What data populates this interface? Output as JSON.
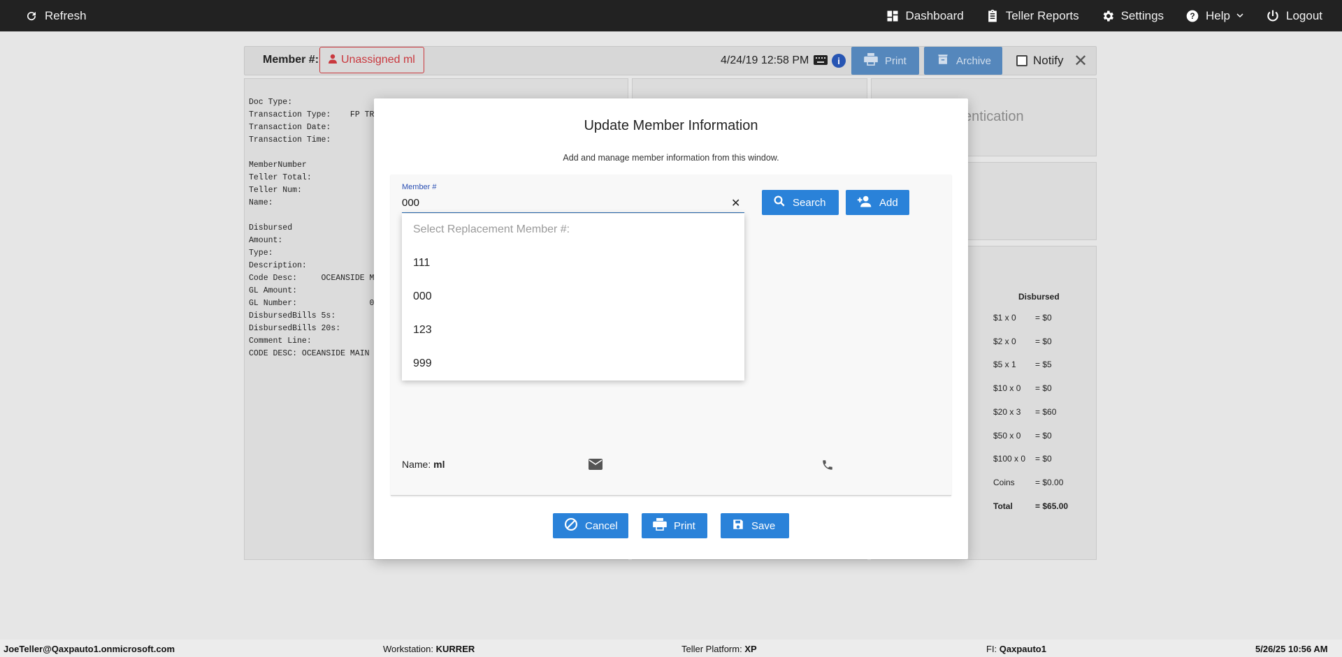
{
  "topnav": {
    "refresh": "Refresh",
    "dashboard": "Dashboard",
    "teller_reports": "Teller Reports",
    "settings": "Settings",
    "help": "Help",
    "logout": "Logout"
  },
  "doc_header": {
    "member_label": "Member #:",
    "unassigned": "Unassigned ml",
    "datetime": "4/24/19 12:58 PM",
    "print": "Print",
    "archive": "Archive",
    "notify": "Notify"
  },
  "doc_text": {
    "lines": [
      "Doc Type:",
      "Transaction Type:    FP TRA",
      "Transaction Date:",
      "Transaction Time:",
      "",
      "MemberNumber",
      "Teller Total:",
      "Teller Num:",
      "Name:",
      "",
      "Disbursed",
      "Amount:",
      "Type:",
      "Description:",
      "Code Desc:     OCEANSIDE MA",
      "GL Amount:",
      "GL Number:               0",
      "DisbursedBills 5s:",
      "DisbursedBills 20s:",
      "Comment Line:",
      "CODE DESC: OCEANSIDE MAIN V"
    ]
  },
  "auth_panel": {
    "partial_title": "entication"
  },
  "disbursed": {
    "title": "Disbursed",
    "rows": [
      {
        "label": "$1 x 0",
        "value": "= $0"
      },
      {
        "label": "$2 x 0",
        "value": "= $0"
      },
      {
        "label": "$5 x 1",
        "value": "= $5"
      },
      {
        "label": "$10 x 0",
        "value": "= $0"
      },
      {
        "label": "$20 x 3",
        "value": "= $60"
      },
      {
        "label": "$50 x 0",
        "value": "= $0"
      },
      {
        "label": "$100 x 0",
        "value": "= $0"
      },
      {
        "label": "Coins",
        "value": "= $0.00"
      },
      {
        "label": "Total",
        "value": "= $65.00"
      }
    ]
  },
  "modal": {
    "title": "Update Member Information",
    "subtitle": "Add and manage member information from this window.",
    "member_field_label": "Member #",
    "member_value": "000",
    "search": "Search",
    "add": "Add",
    "dropdown_placeholder": "Select Replacement Member #:",
    "options": [
      "111",
      "000",
      "123",
      "999"
    ],
    "name_label": "Name:",
    "name_value": "ml",
    "cancel": "Cancel",
    "print": "Print",
    "save": "Save"
  },
  "statusbar": {
    "user": "JoeTeller@Qaxpauto1.onmicrosoft.com",
    "workstation_label": "Workstation:",
    "workstation": "KURRER",
    "platform_label": "Teller Platform:",
    "platform": "XP",
    "fi_label": "FI:",
    "fi": "Qaxpauto1",
    "datetime": "5/26/25 10:56 AM"
  },
  "colors": {
    "accent": "#2a82d9",
    "topbar": "#222222",
    "danger": "#c9383e"
  }
}
